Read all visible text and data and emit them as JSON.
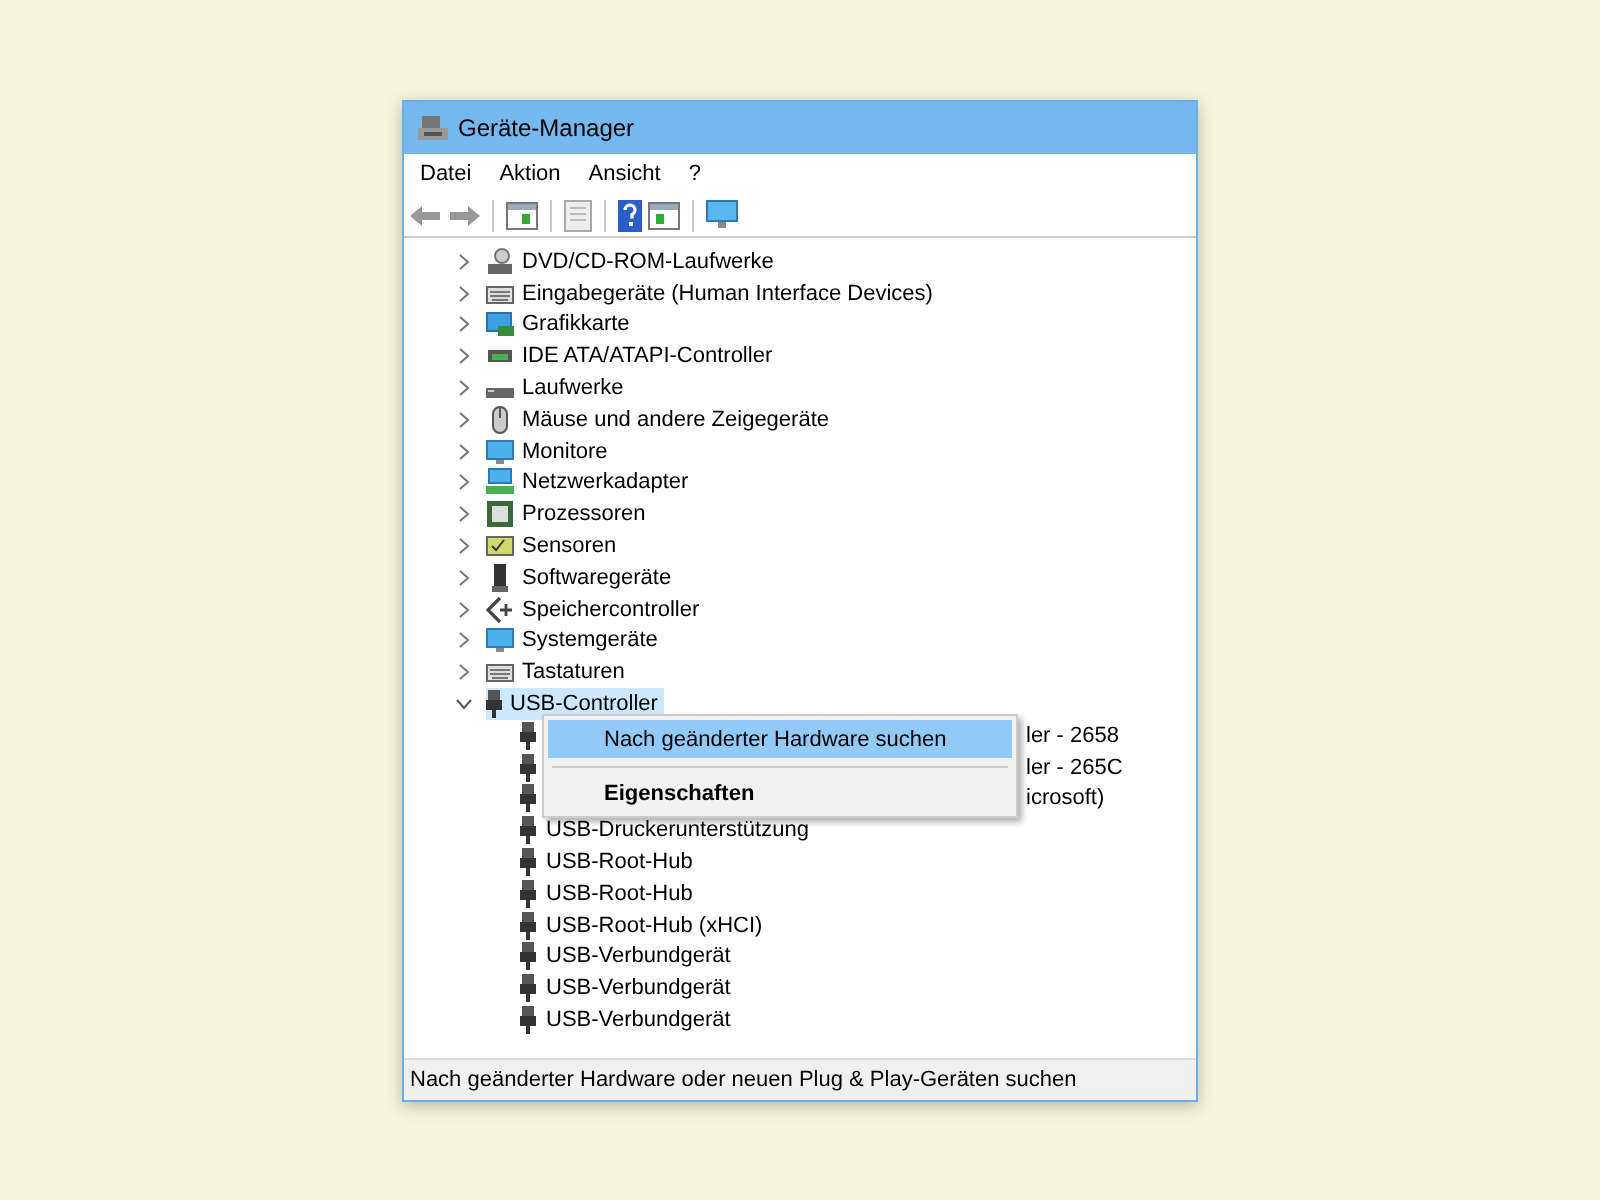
{
  "window": {
    "title": "Geräte-Manager"
  },
  "menu": [
    "Datei",
    "Aktion",
    "Ansicht",
    "?"
  ],
  "tree": [
    {
      "label": "DVD/CD-ROM-Laufwerke",
      "expanded": false,
      "selected": false
    },
    {
      "label": "Eingabegeräte (Human Interface Devices)",
      "expanded": false,
      "selected": false
    },
    {
      "label": "Grafikkarte",
      "expanded": false,
      "selected": false
    },
    {
      "label": "IDE ATA/ATAPI-Controller",
      "expanded": false,
      "selected": false
    },
    {
      "label": "Laufwerke",
      "expanded": false,
      "selected": false
    },
    {
      "label": "Mäuse und andere Zeigegeräte",
      "expanded": false,
      "selected": false
    },
    {
      "label": "Monitore",
      "expanded": false,
      "selected": false
    },
    {
      "label": "Netzwerkadapter",
      "expanded": false,
      "selected": false
    },
    {
      "label": "Prozessoren",
      "expanded": false,
      "selected": false
    },
    {
      "label": "Sensoren",
      "expanded": false,
      "selected": false
    },
    {
      "label": "Softwaregeräte",
      "expanded": false,
      "selected": false
    },
    {
      "label": "Speichercontroller",
      "expanded": false,
      "selected": false
    },
    {
      "label": "Systemgeräte",
      "expanded": false,
      "selected": false
    },
    {
      "label": "Tastaturen",
      "expanded": false,
      "selected": false
    },
    {
      "label": "USB-Controller",
      "expanded": true,
      "selected": true,
      "children": [
        {
          "label": "ler - 2658",
          "kind": "partial",
          "selected": false
        },
        {
          "label": "ler - 265C",
          "kind": "partial",
          "selected": false
        },
        {
          "label": "icrosoft)",
          "kind": "partial",
          "selected": false
        },
        {
          "label": "USB-Druckerunterstützung",
          "kind": "item",
          "selected": false
        },
        {
          "label": "USB-Root-Hub",
          "kind": "item",
          "selected": false
        },
        {
          "label": "USB-Root-Hub",
          "kind": "item",
          "selected": false
        },
        {
          "label": "USB-Root-Hub (xHCI)",
          "kind": "item",
          "selected": false
        },
        {
          "label": "USB-Verbundgerät",
          "kind": "item",
          "selected": false
        },
        {
          "label": "USB-Verbundgerät",
          "kind": "item",
          "selected": false
        },
        {
          "label": "USB-Verbundgerät",
          "kind": "item",
          "selected": false
        }
      ]
    }
  ],
  "context_menu": [
    {
      "label": "Nach geänderter Hardware suchen",
      "selected": true,
      "bold": false
    },
    {
      "label": "Eigenschaften",
      "selected": false,
      "bold": true
    }
  ],
  "status_bar": "Nach geänderter Hardware oder neuen Plug & Play-Geräten suchen"
}
